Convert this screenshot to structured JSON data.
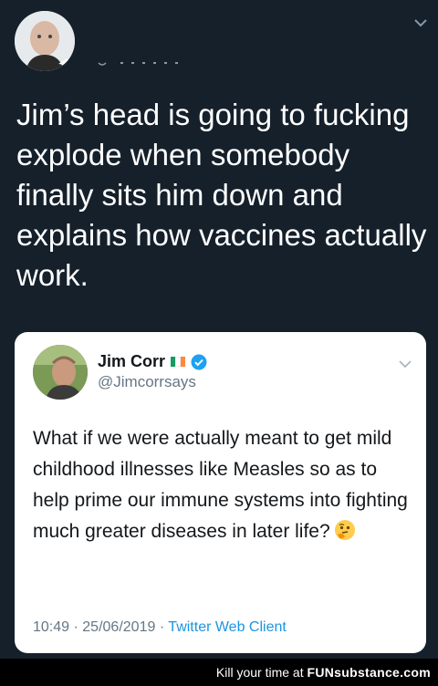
{
  "outer_tweet": {
    "text": "Jim’s head is going to fucking explode when somebody finally sits him down and explains how vaccines actually work."
  },
  "quoted_tweet": {
    "name": "Jim Corr",
    "handle": "@Jimcorrsays",
    "text": "What if we were actually meant to get mild childhood illnesses like Measles so as to help prime our immune systems into fighting much greater diseases in later life?",
    "emoji": "thinking-face",
    "time": "10:49",
    "date": "25/06/2019",
    "client": "Twitter Web Client",
    "separator": "·",
    "flag_colors": [
      "#169b62",
      "#ffffff",
      "#ff883e"
    ],
    "verified_color": "#1da1f2"
  },
  "footer": {
    "tagline": "Kill your time at",
    "brand": "FUNsubstance.com"
  },
  "colors": {
    "background": "#15202b",
    "card": "#ffffff",
    "link": "#1b95e0"
  }
}
